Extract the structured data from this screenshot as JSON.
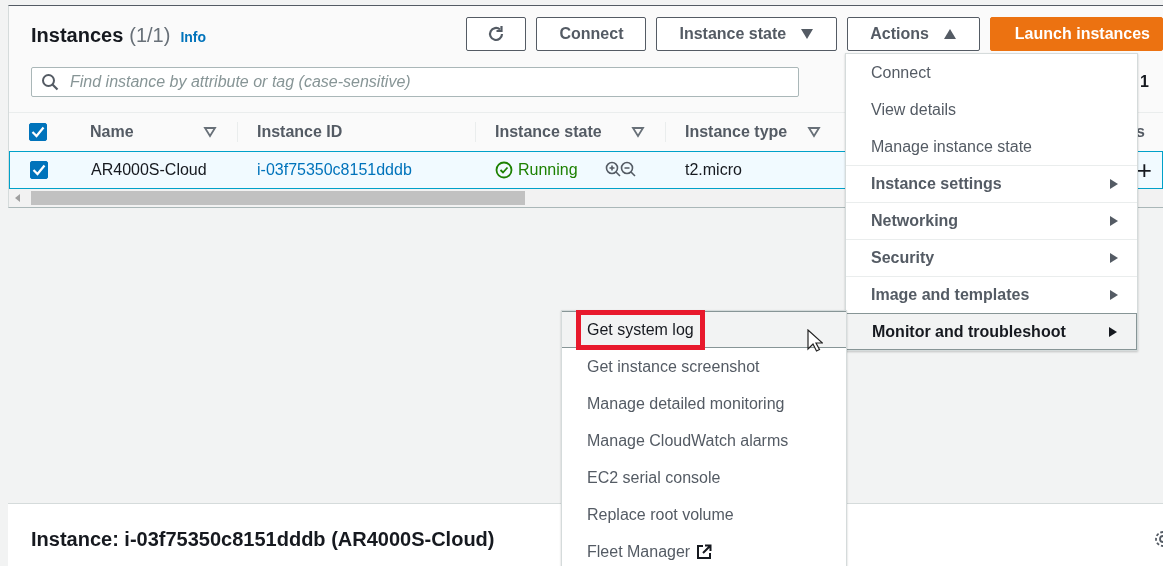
{
  "instances_panel": {
    "title": "Instances",
    "count": "(1/1)",
    "info_link": "Info",
    "buttons": [
      {
        "kind": "refresh"
      },
      {
        "kind": "text",
        "label": "Connect"
      },
      {
        "kind": "dropdown",
        "label": "Instance state",
        "expanded": false
      },
      {
        "kind": "dropdown",
        "label": "Actions",
        "expanded": true
      },
      {
        "kind": "primary",
        "label": "Launch instances"
      }
    ],
    "search": {
      "placeholder": "Find instance by attribute or tag (case-sensitive)"
    },
    "pagination_page": "1",
    "table": {
      "all_checked": true,
      "columns": [
        {
          "label": "Name",
          "sortable": true
        },
        {
          "label": "Instance ID",
          "sortable": false
        },
        {
          "label": "Instance state",
          "sortable": true
        },
        {
          "label": "Instance type",
          "sortable": true
        },
        {
          "label": "s",
          "sortable": false
        }
      ],
      "rows": [
        {
          "selected": true,
          "name": "AR4000S-Cloud",
          "instance_id": "i-03f75350c8151dddb",
          "state": "Running",
          "type": "t2.micro",
          "column_5": "+"
        }
      ]
    }
  },
  "actions_menu": {
    "items": [
      {
        "kind": "action",
        "label": "Connect",
        "selected": false
      },
      {
        "kind": "action",
        "label": "View details",
        "selected": false
      },
      {
        "kind": "action",
        "label": "Manage instance state",
        "selected": false
      },
      {
        "kind": "submenu",
        "label": "Instance settings",
        "selected": false
      },
      {
        "kind": "submenu",
        "label": "Networking",
        "selected": false
      },
      {
        "kind": "submenu",
        "label": "Security",
        "selected": false
      },
      {
        "kind": "submenu",
        "label": "Image and templates",
        "selected": false
      },
      {
        "kind": "submenu",
        "label": "Monitor and troubleshoot",
        "selected": true
      }
    ]
  },
  "submenu": {
    "items": [
      {
        "kind": "action",
        "label": "Get system log",
        "selected": true,
        "annotated": true
      },
      {
        "kind": "action",
        "label": "Get instance screenshot",
        "selected": false,
        "annotated": false
      },
      {
        "kind": "action",
        "label": "Manage detailed monitoring",
        "selected": false,
        "annotated": false
      },
      {
        "kind": "action",
        "label": "Manage CloudWatch alarms",
        "selected": false,
        "annotated": false
      },
      {
        "kind": "action",
        "label": "EC2 serial console",
        "selected": false,
        "annotated": false
      },
      {
        "kind": "action",
        "label": "Replace root volume",
        "selected": false,
        "annotated": false
      },
      {
        "kind": "external",
        "label": "Fleet Manager",
        "selected": false,
        "annotated": false
      }
    ]
  },
  "details_panel": {
    "title": "Instance: i-03f75350c8151dddb (AR4000S-Cloud)"
  }
}
